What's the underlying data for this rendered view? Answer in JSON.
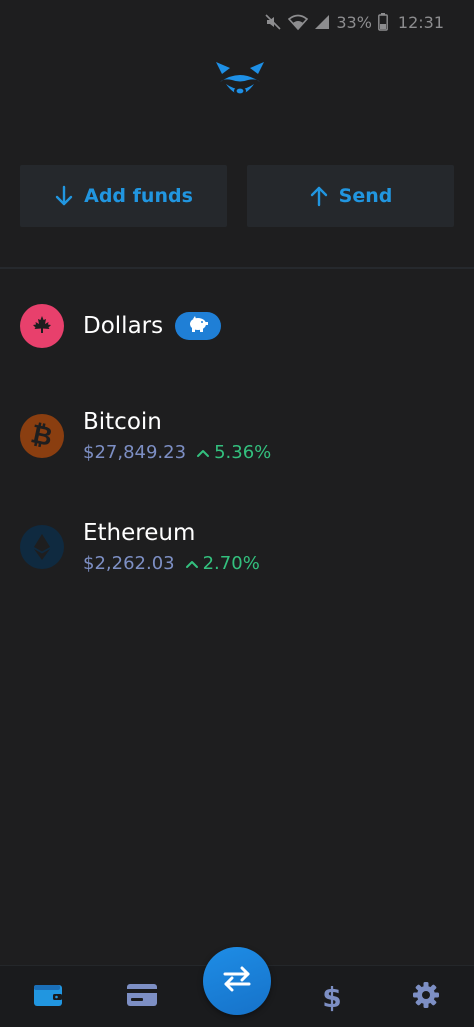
{
  "status_bar": {
    "battery": "33%",
    "time": "12:31"
  },
  "colors": {
    "background": "#1e1e1f",
    "accent": "#2196e0",
    "price": "#7d8fc4",
    "gain": "#33c07e",
    "card": "#25282c"
  },
  "header": {
    "logo_icon": "raccoon-logo-icon"
  },
  "actions": {
    "add_funds": {
      "label": "Add funds",
      "icon": "arrow-down-icon"
    },
    "send": {
      "label": "Send",
      "icon": "arrow-up-icon"
    }
  },
  "assets": [
    {
      "name": "Dollars",
      "icon": "maple-leaf-icon",
      "badge_icon": "piggy-bank-icon"
    },
    {
      "name": "Bitcoin",
      "icon": "bitcoin-icon",
      "price": "$27,849.23",
      "change": "5.36%"
    },
    {
      "name": "Ethereum",
      "icon": "ethereum-icon",
      "price": "$2,262.03",
      "change": "2.70%"
    }
  ],
  "bottom_nav": [
    {
      "icon": "wallet-icon",
      "active": true
    },
    {
      "icon": "card-icon",
      "active": false
    },
    {
      "icon": "swap-icon",
      "active": false
    },
    {
      "icon": "dollar-icon",
      "active": false
    },
    {
      "icon": "gear-icon",
      "active": false
    }
  ]
}
